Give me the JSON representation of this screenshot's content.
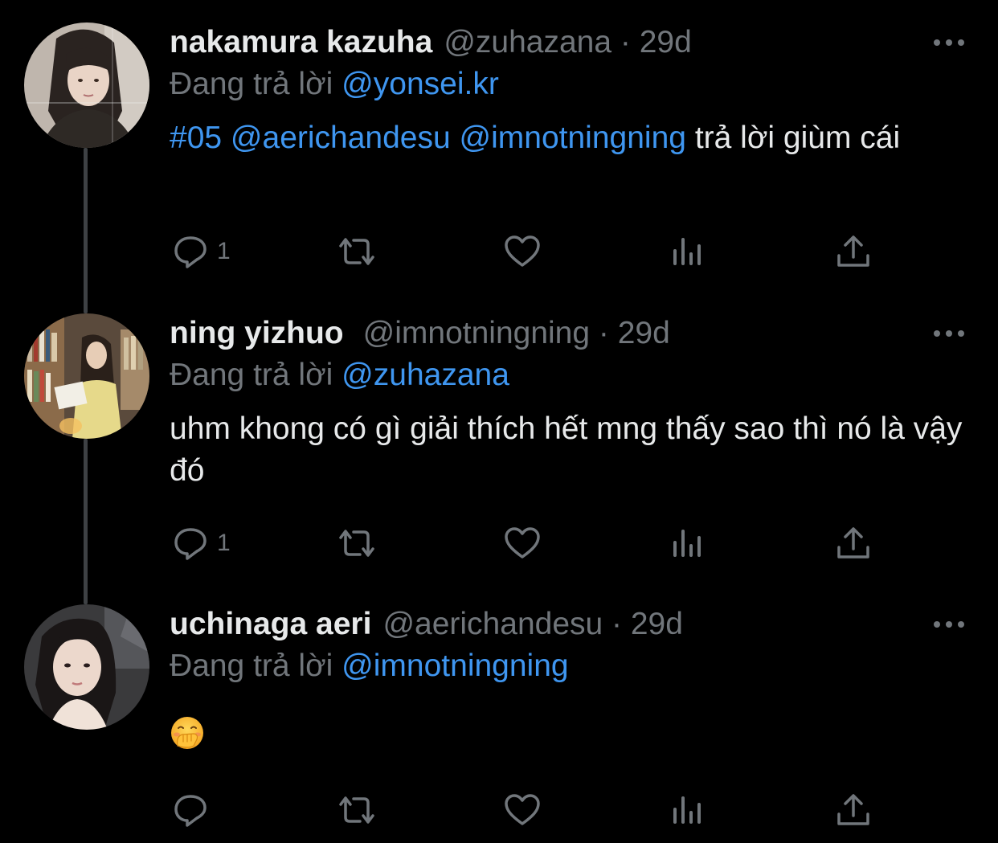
{
  "colors": {
    "background": "#000000",
    "text": "#e7e9ea",
    "secondary": "#71767b",
    "link": "#3f96f0",
    "thread_line": "#3e4144"
  },
  "tweets": [
    {
      "name": "nakamura kazuha",
      "handle": "@zuhazana",
      "time": "· 29d",
      "replying_label": "Đang trả lời",
      "replying_to": "@yonsei.kr",
      "body_hashtag": "#05",
      "body_mention_1": "@aerichandesu",
      "body_mention_2": "@imnotningning",
      "body_text": "trả lời giùm cái",
      "reply_count": "1",
      "icons": [
        "more-icon",
        "reply-icon",
        "retweet-icon",
        "like-icon",
        "analytics-icon",
        "share-icon"
      ]
    },
    {
      "name": "ning yizhuo",
      "handle": "@imnotningning",
      "time": "· 29d",
      "replying_label": "Đang trả lời",
      "replying_to": "@zuhazana",
      "body_text": "uhm khong có gì giải thích hết mng thấy sao thì nó là vậy đó",
      "reply_count": "1"
    },
    {
      "name": "uchinaga aeri",
      "handle": "@aerichandesu",
      "time": "· 29d",
      "replying_label": "Đang trả lời",
      "replying_to": "@imnotningning",
      "body_emoji": "face-with-hand-over-mouth",
      "reply_count": ""
    }
  ]
}
